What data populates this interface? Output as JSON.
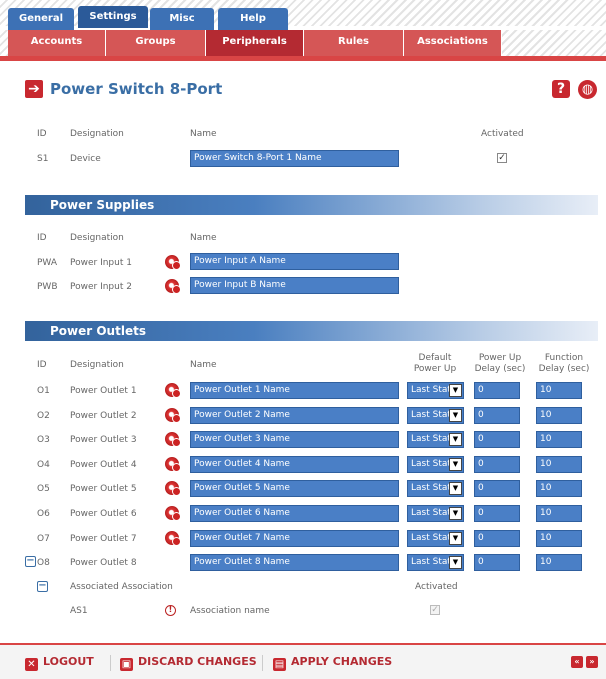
{
  "tabs_main": [
    {
      "label": "General"
    },
    {
      "label": "Settings"
    },
    {
      "label": "Misc"
    },
    {
      "label": "Help"
    }
  ],
  "tabs_sub": [
    {
      "label": "Accounts"
    },
    {
      "label": "Groups"
    },
    {
      "label": "Peripherals"
    },
    {
      "label": "Rules"
    },
    {
      "label": "Associations"
    }
  ],
  "page_title": "Power Switch 8-Port",
  "device": {
    "headers": {
      "id": "ID",
      "designation": "Designation",
      "name": "Name",
      "activated": "Activated"
    },
    "id": "S1",
    "designation": "Device",
    "name": "Power Switch 8-Port 1 Name"
  },
  "power_supplies": {
    "title": "Power Supplies",
    "headers": {
      "id": "ID",
      "designation": "Designation",
      "name": "Name"
    },
    "rows": [
      {
        "id": "PWA",
        "designation": "Power Input 1",
        "name": "Power Input A Name"
      },
      {
        "id": "PWB",
        "designation": "Power Input 2",
        "name": "Power Input B Name"
      }
    ]
  },
  "power_outlets": {
    "title": "Power Outlets",
    "headers": {
      "id": "ID",
      "designation": "Designation",
      "name": "Name",
      "default_power_up_1": "Default",
      "default_power_up_2": "Power Up",
      "power_up_delay_1": "Power Up",
      "power_up_delay_2": "Delay (sec)",
      "function_delay_1": "Function",
      "function_delay_2": "Delay (sec)"
    },
    "rows": [
      {
        "id": "O1",
        "designation": "Power Outlet 1",
        "name": "Power Outlet 1 Name",
        "default": "Last State",
        "pu_delay": "0",
        "fn_delay": "10"
      },
      {
        "id": "O2",
        "designation": "Power Outlet 2",
        "name": "Power Outlet 2 Name",
        "default": "Last State",
        "pu_delay": "0",
        "fn_delay": "10"
      },
      {
        "id": "O3",
        "designation": "Power Outlet 3",
        "name": "Power Outlet 3 Name",
        "default": "Last State",
        "pu_delay": "0",
        "fn_delay": "10"
      },
      {
        "id": "O4",
        "designation": "Power Outlet 4",
        "name": "Power Outlet 4 Name",
        "default": "Last State",
        "pu_delay": "0",
        "fn_delay": "10"
      },
      {
        "id": "O5",
        "designation": "Power Outlet 5",
        "name": "Power Outlet 5 Name",
        "default": "Last State",
        "pu_delay": "0",
        "fn_delay": "10"
      },
      {
        "id": "O6",
        "designation": "Power Outlet 6",
        "name": "Power Outlet 6 Name",
        "default": "Last State",
        "pu_delay": "0",
        "fn_delay": "10"
      },
      {
        "id": "O7",
        "designation": "Power Outlet 7",
        "name": "Power Outlet 7 Name",
        "default": "Last State",
        "pu_delay": "0",
        "fn_delay": "10"
      },
      {
        "id": "O8",
        "designation": "Power Outlet 8",
        "name": "Power Outlet 8 Name",
        "default": "Last State",
        "pu_delay": "0",
        "fn_delay": "10"
      }
    ],
    "association": {
      "header_label": "Associated Association",
      "activated_label": "Activated",
      "id": "AS1",
      "name": "Association name"
    }
  },
  "footer": {
    "logout": "LOGOUT",
    "discard": "DISCARD CHANGES",
    "apply": "APPLY CHANGES"
  },
  "colors": {
    "accent_red": "#c8282f",
    "accent_blue": "#3a6ea5",
    "field_blue": "#4a7fc6"
  }
}
